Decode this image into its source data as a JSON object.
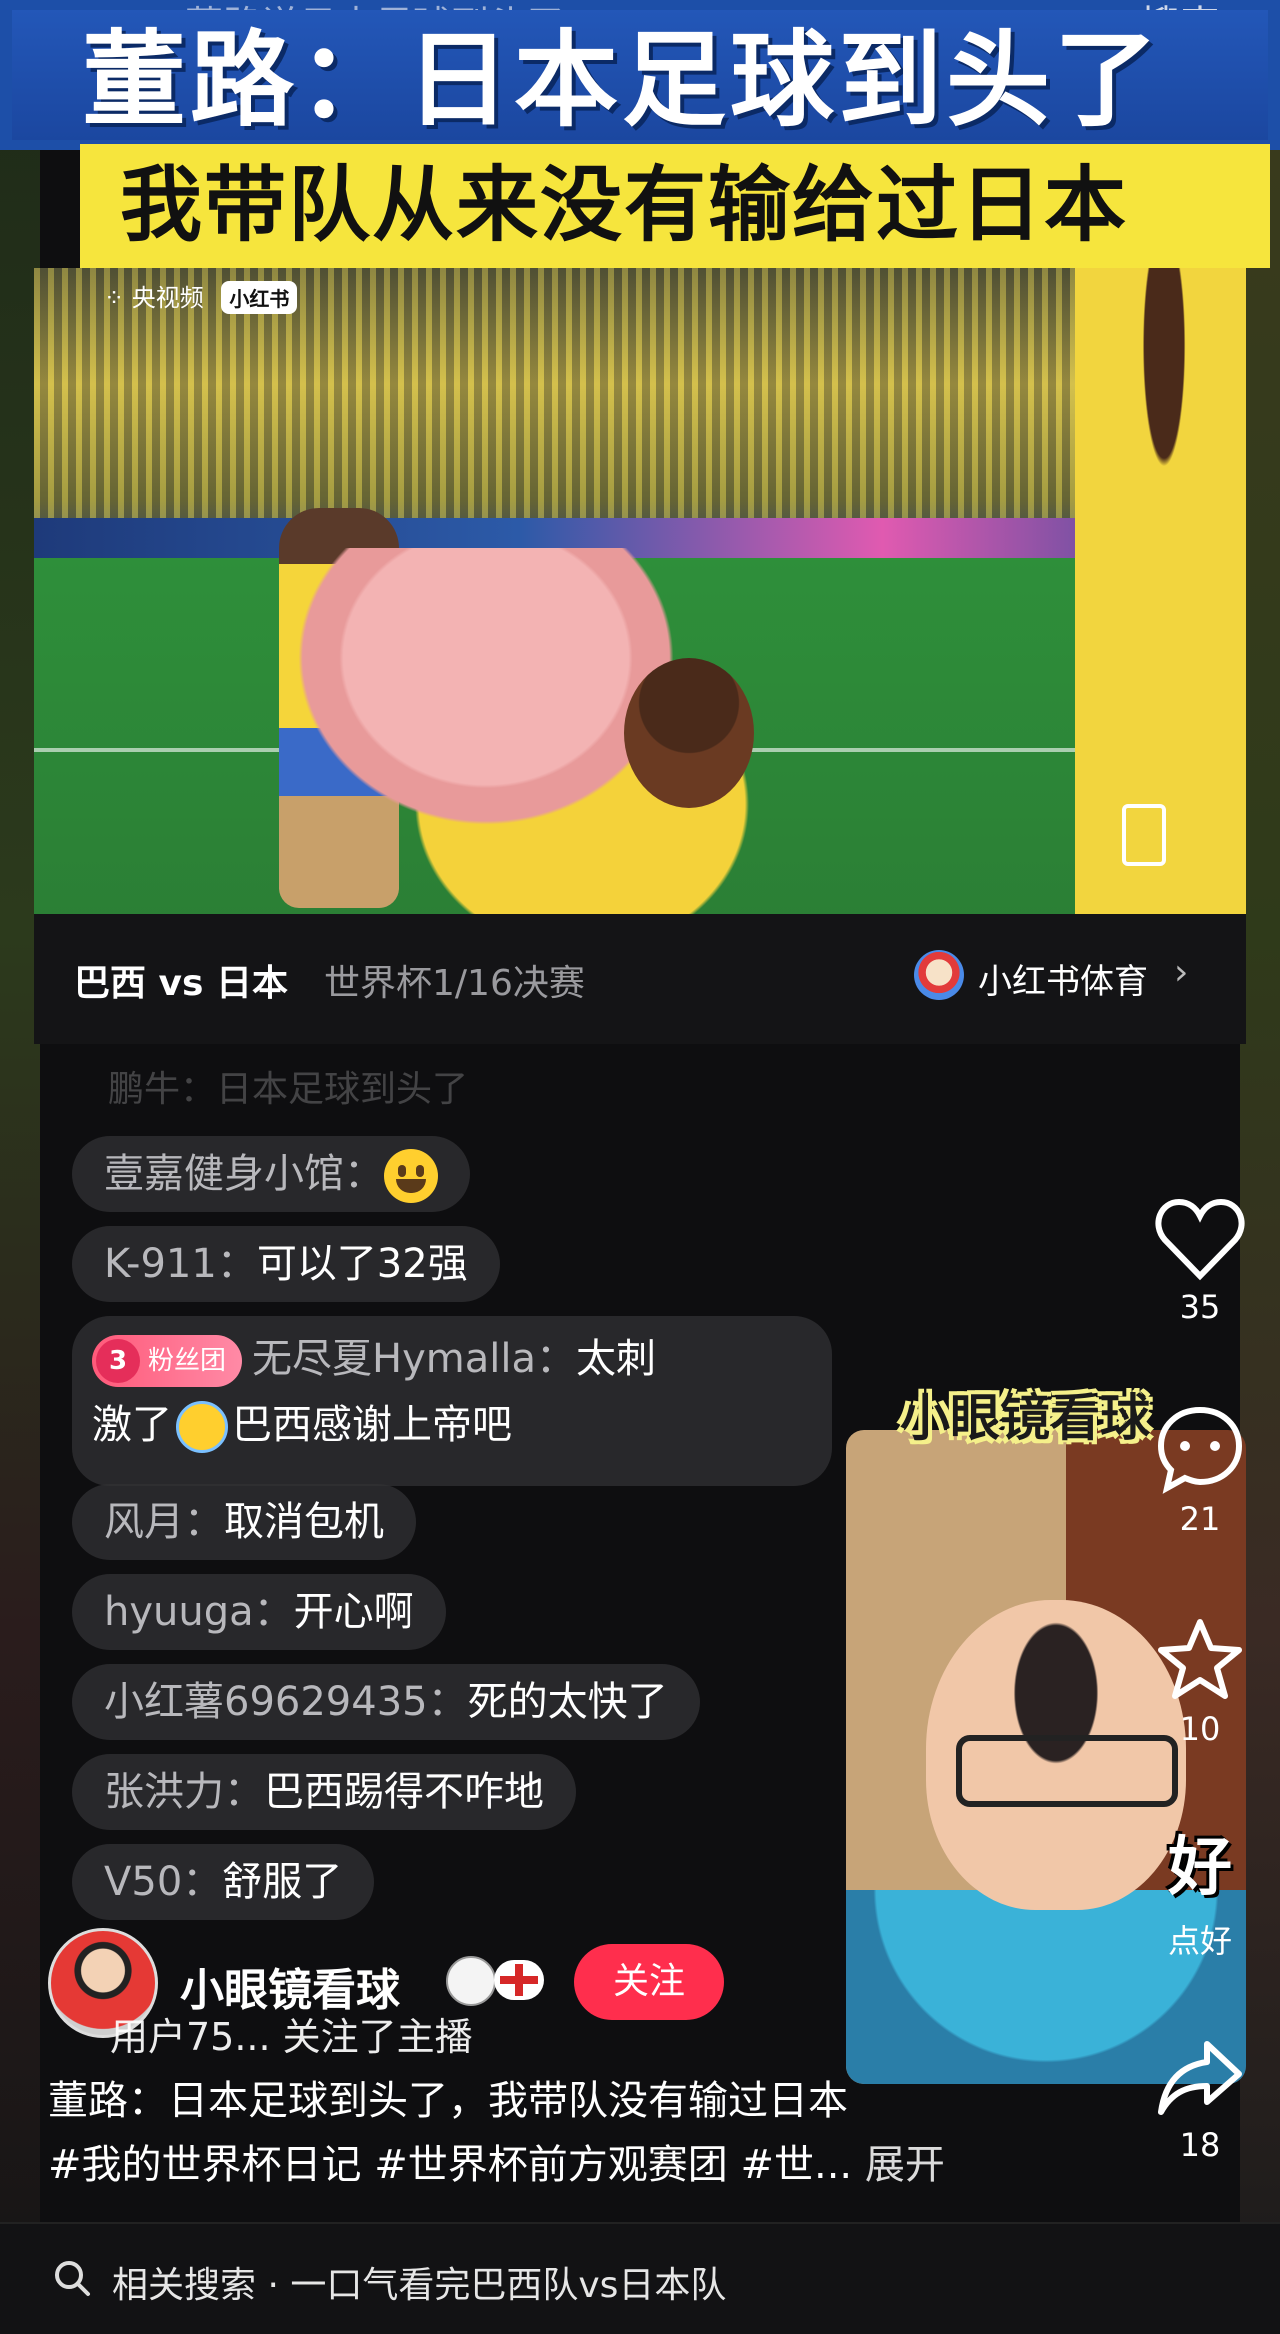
{
  "top_search": {
    "back_glyph": "‹",
    "query": "董路说日本足球到头了",
    "search_label": "搜索"
  },
  "headline": "董路：日本足球到头了",
  "subheadline": "我带队从来没有输给过日本",
  "video": {
    "source_label": "央视频",
    "source_badge": "小红书"
  },
  "match_info": {
    "title": "巴西 vs 日本",
    "subtitle": "世界杯1/16决赛",
    "account": "小红书体育",
    "chevron": "›"
  },
  "comments": {
    "faded": "鹏牛：日本足球到头了",
    "items": [
      {
        "user": "壹嘉健身小馆：",
        "msg": ""
      },
      {
        "user": "K-911：",
        "msg": "可以了32强"
      },
      {
        "user": "风月：",
        "msg": "取消包机"
      },
      {
        "user": "hyuuga：",
        "msg": "开心啊"
      },
      {
        "user": "小红薯69629435：",
        "msg": "死的太快了"
      },
      {
        "user": "张洪力：",
        "msg": "巴西踢得不咋地"
      },
      {
        "user": "V50：",
        "msg": "舒服了"
      }
    ],
    "fan": {
      "badge_level": "3",
      "badge_label": "粉丝团",
      "user": "无尽夏Hymalla：",
      "msg_line1": "太刺",
      "msg_line2a": "激了",
      "msg_line2b": "巴西感谢上帝吧"
    }
  },
  "pip_label": "小眼镜看球",
  "actions": {
    "like": "35",
    "comment": "21",
    "star": "10",
    "good_glyph": "好",
    "good": "点好",
    "share": "18"
  },
  "author": {
    "name": "小眼镜看球",
    "follow_label": "关注",
    "follow_notice": "用户75... 关注了主播"
  },
  "description": "董路：日本足球到头了，我带队没有输过日本",
  "tags": "#我的世界杯日记 #世界杯前方观赛团 #世...",
  "expand_label": "展开",
  "related_search": "相关搜索 · 一口气看完巴西队vs日本队"
}
